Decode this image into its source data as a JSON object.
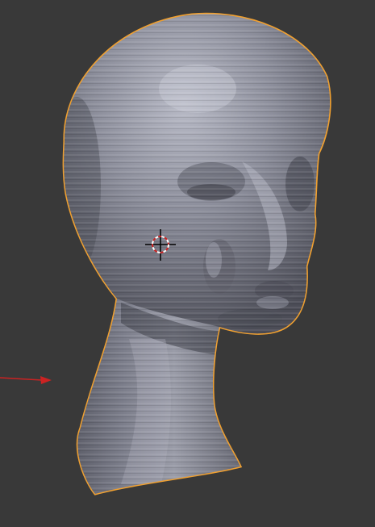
{
  "viewport": {
    "background": "#393939",
    "selection_outline_color": "#f0a030",
    "mesh_color": "#8a8c9a",
    "x_axis_color": "#cc2222"
  },
  "scene": {
    "object": "head-sculpture-mesh",
    "selected": true,
    "cursor": "3d-cursor",
    "axis_indicator": "x-axis-arrow"
  }
}
